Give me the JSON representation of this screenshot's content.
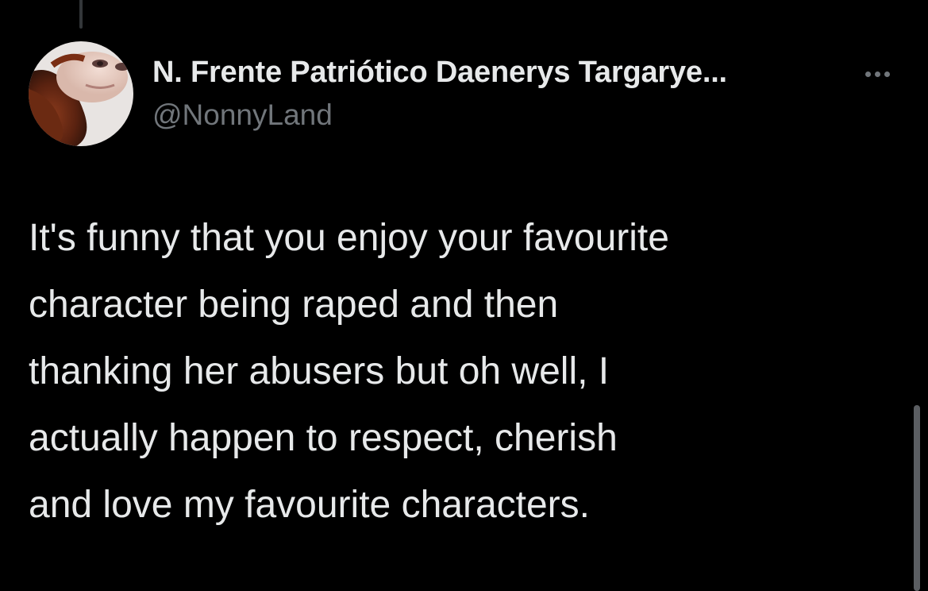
{
  "tweet": {
    "author": {
      "display_name": "N. Frente Patriótico Daenerys Targarye...",
      "handle": "@NonnyLand",
      "avatar_icon": "profile-avatar"
    },
    "more_icon": "more-horizontal-icon",
    "text_lines": [
      "It's funny that you enjoy your favourite",
      "character being raped and then",
      "thanking her abusers but oh well, I",
      "actually happen to respect, cherish",
      "and love my favourite characters."
    ]
  },
  "colors": {
    "background": "#000000",
    "primary_text": "#e7e9ea",
    "secondary_text": "#71767b",
    "thread_line": "#333639"
  }
}
